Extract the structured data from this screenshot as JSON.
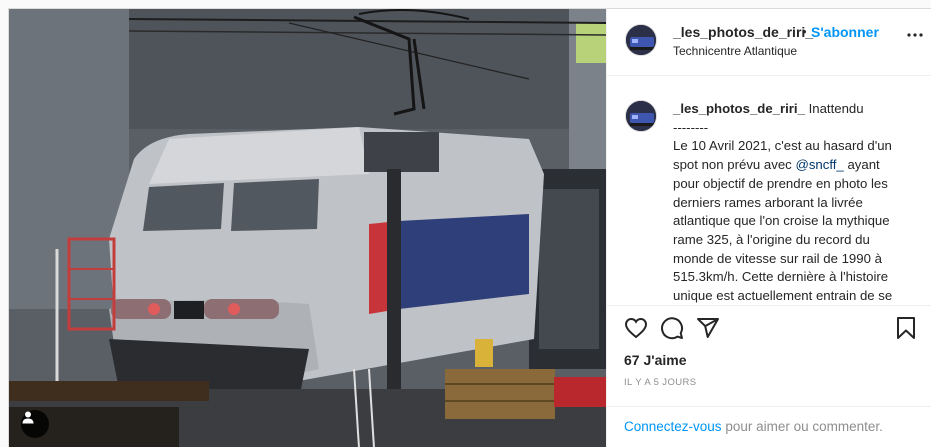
{
  "post": {
    "username": "_les_photos_de_riri_",
    "separator": "•",
    "follow_label": "S'abonner",
    "location": "Technicentre Atlantique",
    "caption": {
      "username": "_les_photos_de_riri_",
      "lines": [
        " Inattendu",
        "--------",
        "Le 10 Avril 2021, c'est au hasard d'un",
        "spot non prévu avec ",
        "pour objectif de prendre en photo les",
        "derniers rames arborant la livrée",
        "atlantique que l'on croise la mythique",
        "rame 325, à l'origine du record du",
        "monde de vitesse sur rail de 1990 à",
        "515.3km/h. Cette dernière à l'histoire",
        "unique est actuellement entrain de se"
      ],
      "mention": "@sncff_",
      "after_mention": " ayant"
    },
    "likes": "67 J'aime",
    "timestamp": "IL Y A 5 JOURS",
    "login_link": "Connectez-vous",
    "login_rest": " pour aimer ou commenter."
  },
  "icons": {
    "more": "more-horizontal-icon",
    "like": "heart-icon",
    "comment": "comment-icon",
    "share": "share-paper-plane-icon",
    "save": "bookmark-icon",
    "tag": "user-tag-icon"
  },
  "colors": {
    "follow": "#0095f6",
    "text": "#262626",
    "muted": "#8e8e8e",
    "border": "#efefef",
    "mention": "#00376b"
  }
}
